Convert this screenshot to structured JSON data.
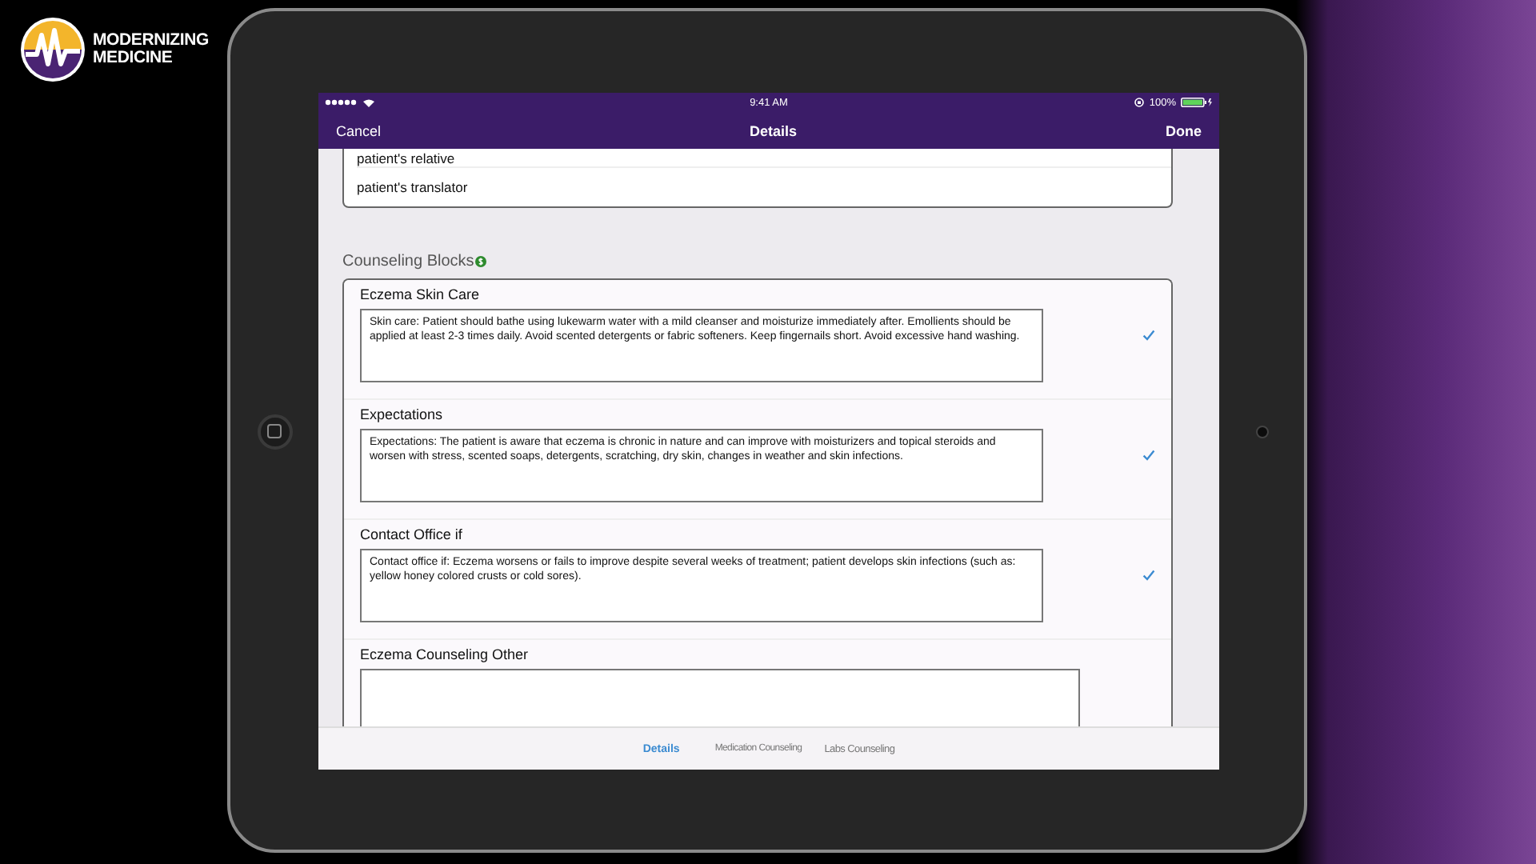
{
  "logo": {
    "lines": [
      "MODERNIZING",
      "MEDICINE"
    ]
  },
  "status_bar": {
    "time": "9:41 AM",
    "battery": "100%"
  },
  "nav_bar": {
    "left": "Cancel",
    "title": "Details",
    "right": "Done"
  },
  "people_list": [
    "patient's relative",
    "patient's translator"
  ],
  "section": {
    "title": "Counseling Blocks"
  },
  "blocks": [
    {
      "title": "Eczema Skin Care",
      "value": "Skin care: Patient should bathe using lukewarm water with a mild cleanser and moisturize immediately after. Emollients should be applied at least 2-3 times daily.  Avoid scented detergents or fabric softeners. Keep fingernails short. Avoid excessive hand washing.",
      "checked": true
    },
    {
      "title": "Expectations",
      "value": "Expectations: The patient is aware that eczema is chronic in nature and can improve with moisturizers and topical steroids and worsen with stress, scented soaps, detergents, scratching, dry skin, changes in weather and skin infections.",
      "checked": true
    },
    {
      "title": "Contact Office if",
      "value": "Contact office if:  Eczema worsens or fails to improve despite several weeks of treatment; patient develops skin infections (such as: yellow honey colored crusts or cold sores).",
      "checked": true
    },
    {
      "title": "Eczema Counseling Other",
      "checked": false
    }
  ],
  "tabs": [
    {
      "label": "Details",
      "selected": true
    },
    {
      "label": "Medication Counseling",
      "selected": false
    },
    {
      "label": "Labs Counseling",
      "selected": false
    }
  ]
}
